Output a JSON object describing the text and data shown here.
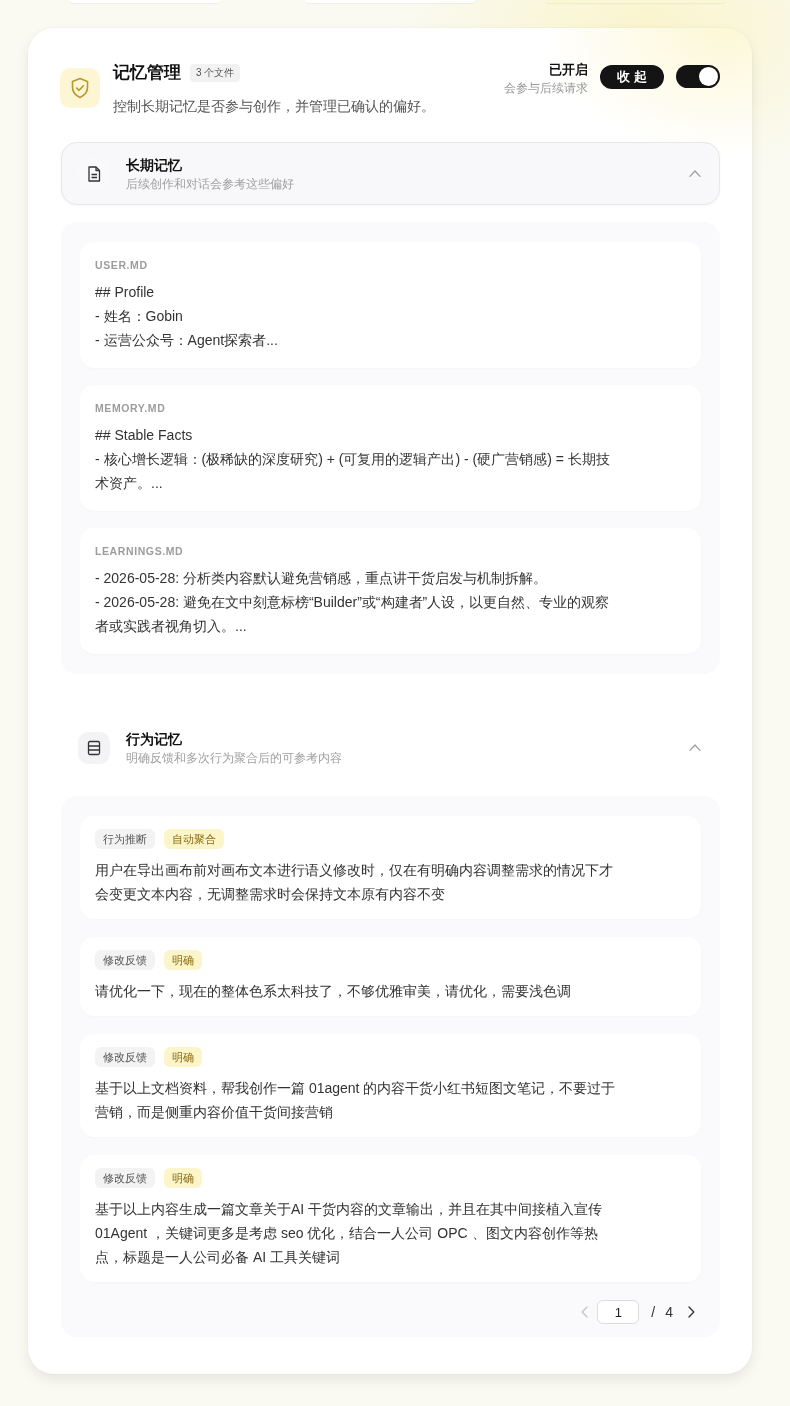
{
  "panel": {
    "title": "记忆管理",
    "file_count": "3 个文件",
    "description": "控制长期记忆是否参与创作，并管理已确认的偏好。",
    "status": "已开启",
    "status_note": "会参与后续请求",
    "collapse_button": "收 起",
    "enabled": true
  },
  "sections": [
    {
      "kind": "files",
      "title": "长期记忆",
      "subtitle": "后续创作和对话会参考这些偏好",
      "selected": true,
      "expanded": true,
      "files": [
        {
          "name": "USER.MD",
          "lines": [
            "## Profile",
            "- 姓名：Gobin",
            "- 运营公众号：Agent探索者..."
          ]
        },
        {
          "name": "MEMORY.MD",
          "lines": [
            "## Stable Facts",
            "- 核心增长逻辑：(极稀缺的深度研究) + (可复用的逻辑产出) - (硬广营销感) = 长期技术资产。..."
          ]
        },
        {
          "name": "LEARNINGS.MD",
          "lines": [
            "- 2026-05-28: 分析类内容默认避免营销感，重点讲干货启发与机制拆解。",
            "- 2026-05-28: 避免在文中刻意标榜“Builder”或“构建者”人设，以更自然、专业的观察者或实践者视角切入。..."
          ]
        }
      ]
    },
    {
      "kind": "behaviors",
      "title": "行为记忆",
      "subtitle": "明确反馈和多次行为聚合后的可参考内容",
      "selected": false,
      "expanded": true,
      "entries": [
        {
          "type": "行为推断",
          "confidence": "自动聚合",
          "text": "用户在导出画布前对画布文本进行语义修改时，仅在有明确内容调整需求的情况下才会变更文本内容，无调整需求时会保持文本原有内容不变"
        },
        {
          "type": "修改反馈",
          "confidence": "明确",
          "text": "请优化一下，现在的整体色系太科技了，不够优雅审美，请优化，需要浅色调"
        },
        {
          "type": "修改反馈",
          "confidence": "明确",
          "text": "基于以上文档资料，帮我创作一篇 01agent 的内容干货小红书短图文笔记，不要过于营销，而是侧重内容价值干货间接营销"
        },
        {
          "type": "修改反馈",
          "confidence": "明确",
          "text": "基于以上内容生成一篇文章关于AI 干货内容的文章输出，并且在其中间接植入宣传 01Agent ，关键词更多是考虑 seo 优化，结合一人公司 OPC 、图文内容创作等热点，标题是一人公司必备 AI 工具关键词"
        }
      ],
      "pagination": {
        "prev_disabled": true,
        "page": "1",
        "separator": "/",
        "total": "4",
        "next_disabled": false
      }
    }
  ]
}
